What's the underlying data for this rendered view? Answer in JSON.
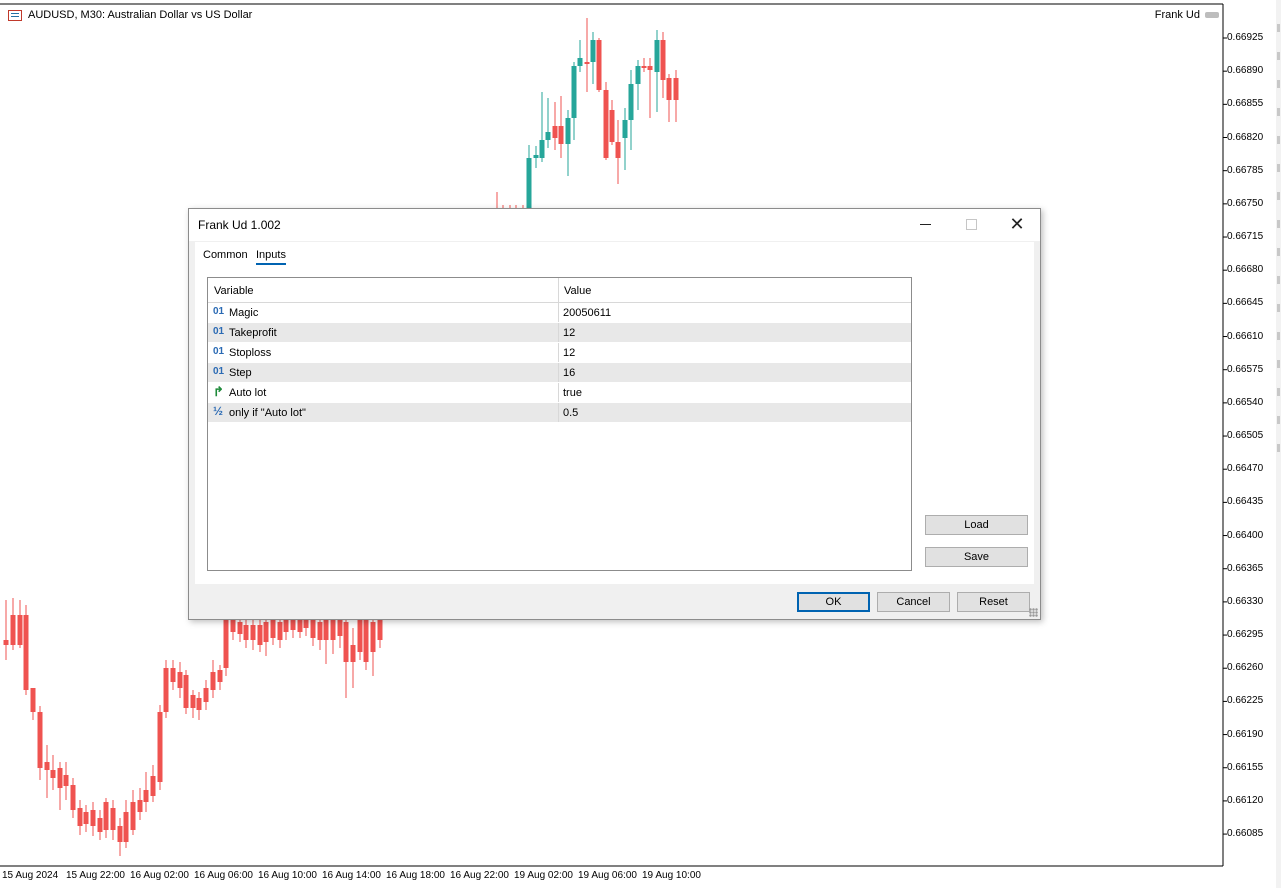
{
  "chart": {
    "symbol_title": "AUDUSD, M30:  Australian Dollar vs US Dollar",
    "expert_name": "Frank Ud",
    "price_axis": [
      "0.66925",
      "0.66890",
      "0.66855",
      "0.66820",
      "0.66785",
      "0.66750",
      "0.66715",
      "0.66680",
      "0.66645",
      "0.66610",
      "0.66575",
      "0.66540",
      "0.66505",
      "0.66470",
      "0.66435",
      "0.66400",
      "0.66365",
      "0.66330",
      "0.66295",
      "0.66260",
      "0.66225",
      "0.66190",
      "0.66155",
      "0.66120",
      "0.66085"
    ],
    "time_axis": [
      "15 Aug 2024",
      "15 Aug 22:00",
      "16 Aug 02:00",
      "16 Aug 06:00",
      "16 Aug 10:00",
      "16 Aug 14:00",
      "16 Aug 18:00",
      "16 Aug 22:00",
      "19 Aug 02:00",
      "19 Aug 06:00",
      "19 Aug 10:00"
    ],
    "colors": {
      "bull": "#26a69a",
      "bear": "#ef5350"
    }
  },
  "dialog": {
    "title": "Frank Ud 1.002",
    "tabs": [
      {
        "label": "Common"
      },
      {
        "label": "Inputs"
      }
    ],
    "grid": {
      "headers": {
        "variable": "Variable",
        "value": "Value"
      },
      "rows": [
        {
          "icon": "integer-icon",
          "glyph": "01",
          "name": "Magic",
          "value": "20050611"
        },
        {
          "icon": "integer-icon",
          "glyph": "01",
          "name": "Takeprofit",
          "value": "12"
        },
        {
          "icon": "integer-icon",
          "glyph": "01",
          "name": "Stoploss",
          "value": "12"
        },
        {
          "icon": "integer-icon",
          "glyph": "01",
          "name": "Step",
          "value": "16"
        },
        {
          "icon": "boolean-icon",
          "glyph": "↱",
          "name": "Auto lot",
          "value": "true"
        },
        {
          "icon": "double-icon",
          "glyph": "½",
          "name": "only if \"Auto lot\"",
          "value": "0.5"
        }
      ]
    },
    "buttons": {
      "load": "Load",
      "save": "Save",
      "ok": "OK",
      "cancel": "Cancel",
      "reset": "Reset"
    }
  }
}
